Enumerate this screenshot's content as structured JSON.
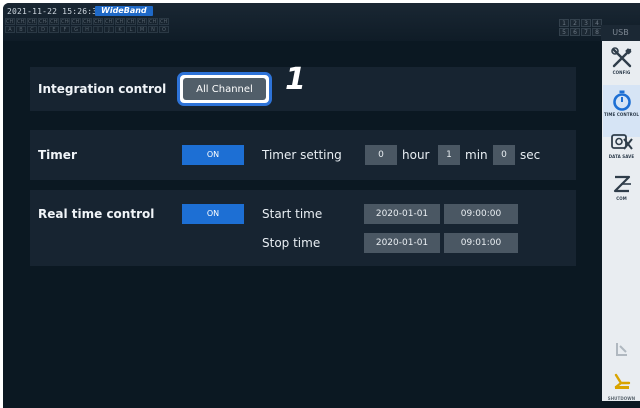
{
  "status": {
    "datetime": "2021-11-22 15:26:30",
    "mode_badge": "WideBand",
    "channel_cells": [
      "CH1",
      "CH2",
      "CH3",
      "CH4",
      "CH5",
      "CH6",
      "CH7",
      "CH8",
      "CH9",
      "CH10",
      "CH11",
      "CH12",
      "CH13",
      "CH14",
      "CH15",
      "A",
      "B",
      "C",
      "D",
      "E",
      "F",
      "G",
      "H",
      "I",
      "J",
      "K",
      "L",
      "M",
      "N",
      "O"
    ],
    "page_cells": [
      "1",
      "2",
      "3",
      "4",
      "5",
      "6",
      "7",
      "8"
    ],
    "usb": "USB"
  },
  "integration": {
    "label": "Integration control",
    "button": "All Channel",
    "step": "1"
  },
  "timer": {
    "label": "Timer",
    "state": "ON",
    "setting_label": "Timer setting",
    "hour_value": "0",
    "hour_unit": "hour",
    "min_value": "1",
    "min_unit": "min",
    "sec_value": "0",
    "sec_unit": "sec"
  },
  "realtime": {
    "label": "Real time control",
    "state": "ON",
    "start_label": "Start time",
    "start_date": "2020-01-01",
    "start_time": "09:00:00",
    "stop_label": "Stop time",
    "stop_date": "2020-01-01",
    "stop_time": "09:01:00"
  },
  "sidebar": {
    "items": [
      {
        "caption": "CONFIG",
        "icon": "wrench-screwdriver-icon"
      },
      {
        "caption": "TIME CONTROL",
        "icon": "stopwatch-icon"
      },
      {
        "caption": "DATA SAVE",
        "icon": "data-save-icon"
      },
      {
        "caption": "COM",
        "icon": "com-icon"
      }
    ],
    "bottom": [
      {
        "caption": "",
        "icon": "hold-icon"
      },
      {
        "caption": "SHUTDOWN",
        "icon": "shutdown-icon"
      }
    ]
  },
  "colors": {
    "background": "#0b1822",
    "panel": "#172431",
    "accent": "#1d6fd4",
    "value_box": "#4a5763"
  }
}
